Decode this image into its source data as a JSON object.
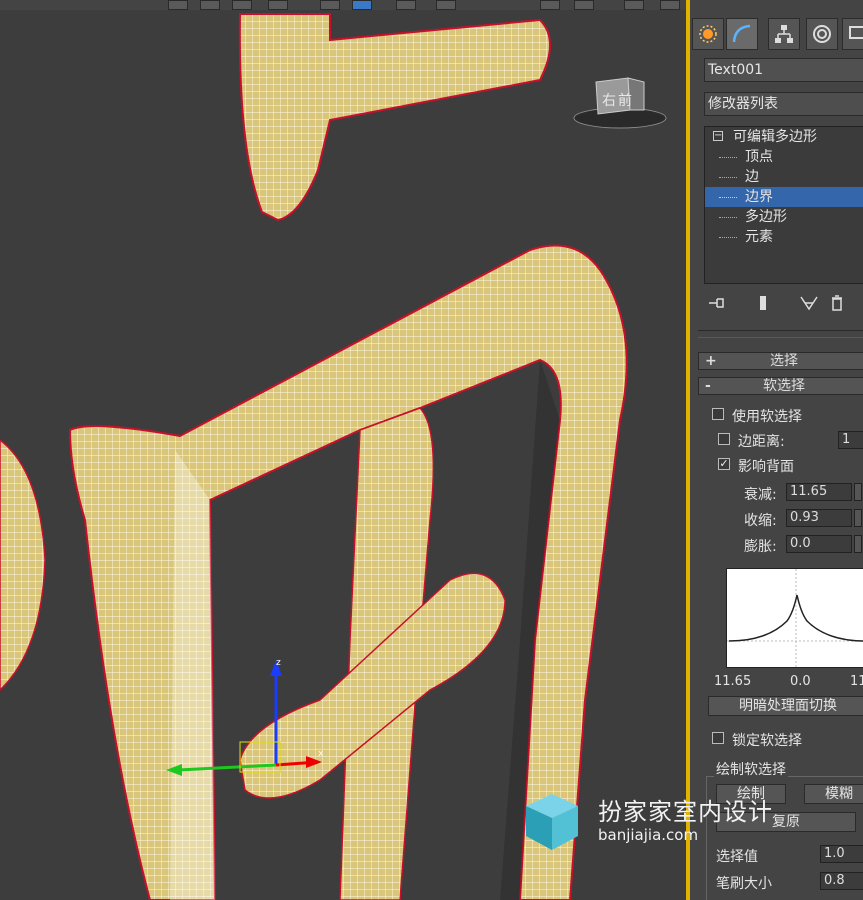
{
  "viewport": {
    "navcube_label": "右前"
  },
  "panel": {
    "object_name": "Text001",
    "modifier_list": "修改器列表",
    "stack": {
      "root": "可编辑多边形",
      "items": [
        "顶点",
        "边",
        "边界",
        "多边形",
        "元素"
      ],
      "selected_index": 2
    },
    "rollouts": {
      "selection": {
        "sign": "+",
        "title": "选择"
      },
      "soft_selection": {
        "sign": "-",
        "title": "软选择"
      }
    },
    "soft": {
      "use_soft_label": "使用软选择",
      "use_soft_checked": false,
      "edge_distance_label": "边距离:",
      "edge_distance_checked": false,
      "edge_distance_value": "1",
      "affect_backface_label": "影响背面",
      "affect_backface_checked": true,
      "falloff_label": "衰减:",
      "falloff_value": "11.65",
      "pinch_label": "收缩:",
      "pinch_value": "0.93",
      "bubble_label": "膨胀:",
      "bubble_value": "0.0",
      "curve_ticks": [
        "11.65",
        "0.0",
        "11"
      ],
      "shaded_face_toggle": "明暗处理面切换",
      "lock_soft_label": "锁定软选择",
      "lock_soft_checked": false,
      "paint_group_title": "绘制软选择",
      "paint_button": "绘制",
      "blur_button": "模糊",
      "revert_button": "复原",
      "select_value_label": "选择值",
      "select_value": "1.0",
      "brush_size_label": "笔刷大小",
      "brush_size": "0.8"
    }
  },
  "watermark": {
    "text": "扮家家室内设计",
    "url": "banjiajia.com"
  }
}
